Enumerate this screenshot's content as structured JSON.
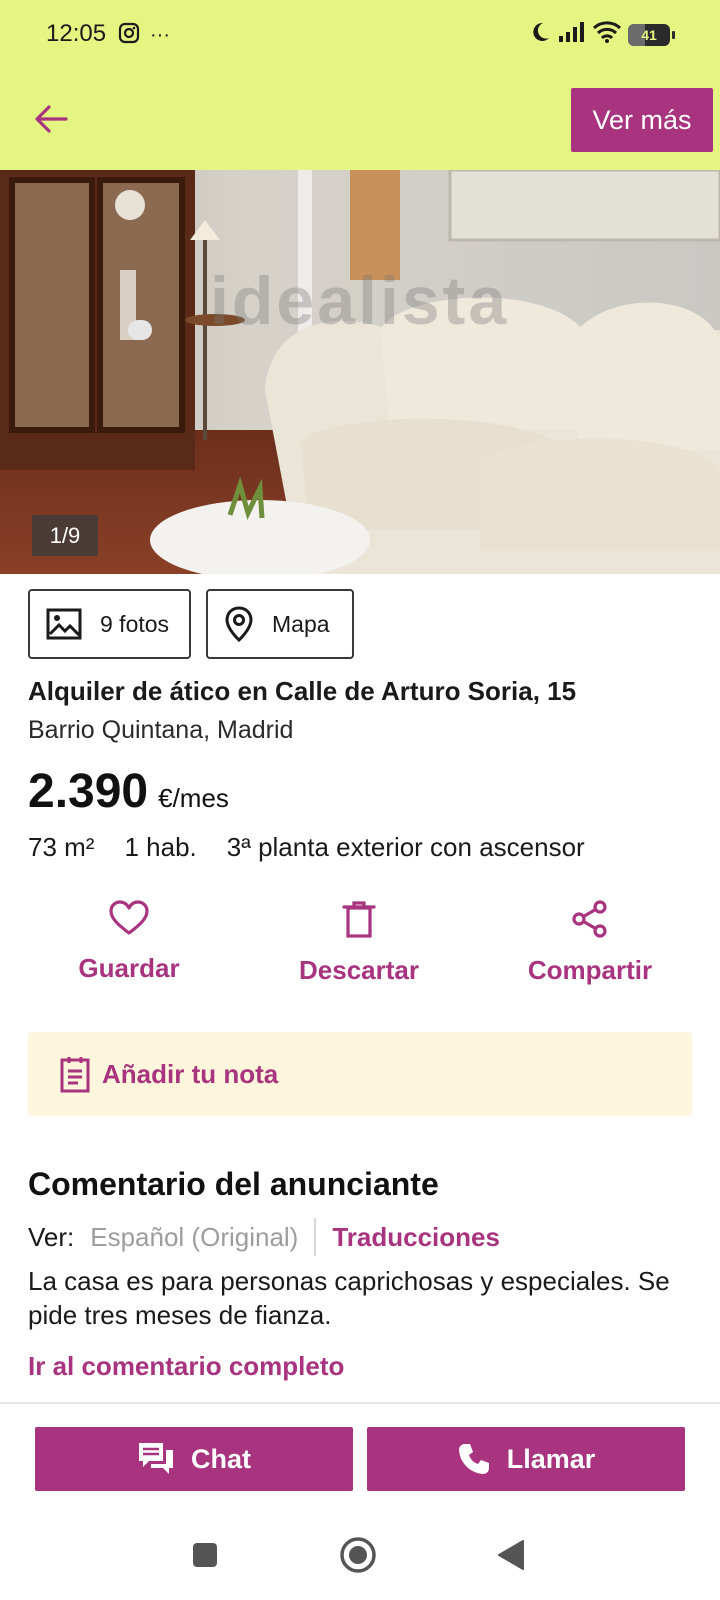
{
  "status_bar": {
    "time": "12:05",
    "more_dots": "···",
    "battery_level": "41",
    "battery_fraction": 0.41
  },
  "app_bar": {
    "ver_mas_label": "Ver más"
  },
  "photo": {
    "counter": "1/9",
    "watermark": "idealista"
  },
  "media_buttons": {
    "photos_label": "9 fotos",
    "map_label": "Mapa"
  },
  "listing": {
    "title": "Alquiler de ático en Calle de Arturo Soria, 15",
    "location": "Barrio Quintana, Madrid",
    "price": "2.390",
    "price_unit": "€/mes",
    "features": [
      "73 m²",
      "1 hab.",
      "3ª planta exterior con ascensor"
    ]
  },
  "actions": {
    "save_label": "Guardar",
    "discard_label": "Descartar",
    "share_label": "Compartir"
  },
  "note": {
    "label": "Añadir tu nota"
  },
  "comment": {
    "section_title": "Comentario del anunciante",
    "view_label": "Ver:",
    "original_label": "Español (Original)",
    "translations_label": "Traducciones",
    "text": "La casa es para personas caprichosas y especiales. Se pide tres meses de fianza.",
    "full_link": "Ir al comentario completo"
  },
  "bottom_actions": {
    "chat_label": "Chat",
    "call_label": "Llamar"
  },
  "colors": {
    "accent": "#a8337e",
    "header_bg": "#e4f582",
    "note_bg": "#fdf6dd"
  }
}
